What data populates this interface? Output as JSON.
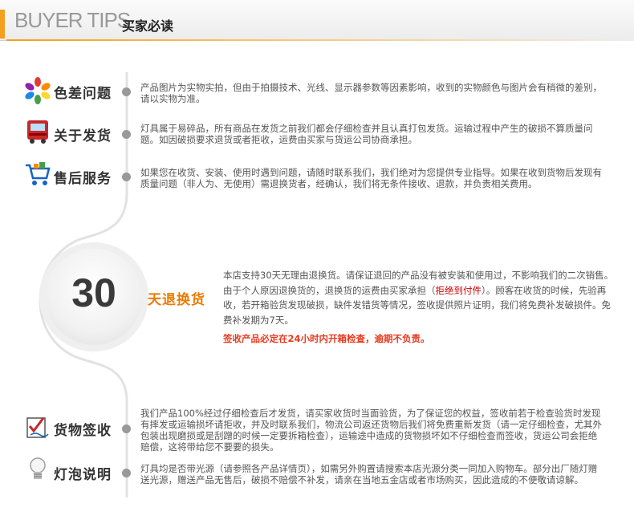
{
  "header": {
    "title_en": "BUYER TIPS",
    "title_cn": "买家必读"
  },
  "rows": [
    {
      "title": "色差问题",
      "icon": "color-palette-icon",
      "text": "产品图片为实物实拍，但由于拍摄技术、光线、显示器参数等因素影响，收到的实物颜色与图片会有稍微的差别，请以实物为准。"
    },
    {
      "title": "关于发货",
      "icon": "delivery-truck-icon",
      "text": "灯具属于易碎品，所有商品在发货之前我们都会仔细检查并且认真打包发货。运输过程中产生的破损不算质量问题。如因破损要求退货或者拒收，运费由买家与货运公司协商承担。"
    },
    {
      "title": "售后服务",
      "icon": "shopping-cart-icon",
      "text": "如果您在收货、安装、使用时遇到问题，请随时联系我们，我们绝对为您提供专业指导。如果在收到货物后发现有质量问题（非人为、无使用）需退换货者，经确认，我们将无条件接收、退款，并负责相关费用。"
    },
    {
      "title": "货物签收",
      "icon": "signature-check-icon",
      "text": "我们产品100%经过仔细检查后才发货，请买家收货时当面验货，为了保证您的权益，签收前若于检查验货时发现有摔发或运输损坏请拒收，并及时联系我们，物流公司返还货物后我们将免费重新发货（请一定仔细检查，尤其外包装出现磨损或是刮蹭的时候一定要拆箱检查），运输途中造成的货物损坏如不仔细检查而签收，货运公司会拒绝赔偿，这将带给您不要要的损失。"
    },
    {
      "title": "灯泡说明",
      "icon": "light-bulb-icon",
      "text": "灯具均是否带光源（请参照各产品详情页），如需另外购置请搜索本店光源分类一同加入购物车。部分出厂随灯赠送光源，赠送产品无售后，破损不赔偿不补发，请亲在当地五金店或者市场购买，因此造成的不便敬请谅解。"
    }
  ],
  "return_policy": {
    "number": "30",
    "label": "天退换货",
    "text_before": "本店支持30天无理由退换货。请保证退回的产品没有被安装和使用过，不影响我们的二次销售。由于个人原因退换货的，退换货的运费由买家承担（",
    "highlight": "拒绝到付件",
    "text_after": "）。顾客在收货的时候，先验再收，若开箱验货发现破损，缺件发错货等情况，签收提供照片证明，我们将免费补发破损件。免费补发期为7天。",
    "warning": "签收产品必定在24小时内开箱检查，逾期不负责。"
  },
  "colors": {
    "accent_orange": "#f2a01d",
    "label_orange": "#e87b00",
    "warning_red": "#e83a1f",
    "timeline_gray": "#e2e2e2"
  }
}
